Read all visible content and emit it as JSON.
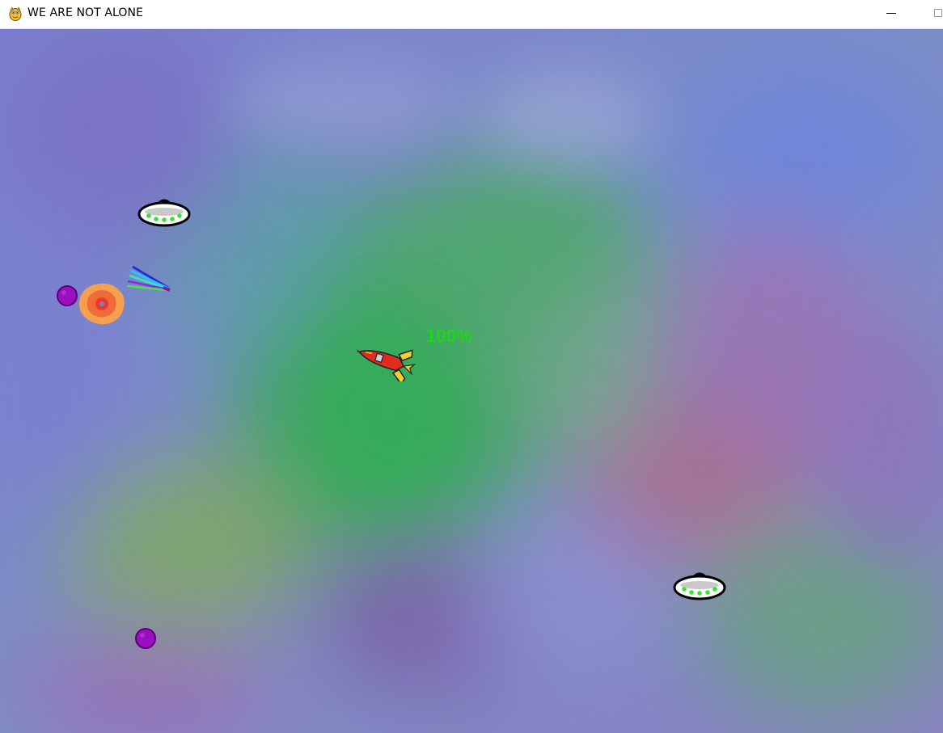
{
  "window": {
    "title": "WE ARE NOT ALONE",
    "icon": "pygame-snake-icon"
  },
  "controls": {
    "minimize_icon": "minimize-icon",
    "maximize_icon": "maximize-icon"
  },
  "hud": {
    "health_text": "100%",
    "health_color": "#1fd61f"
  },
  "colors": {
    "nebula_blue": "#7f87cc",
    "nebula_green": "#3fae5c",
    "nebula_purple": "#8a5fb0",
    "nebula_pink": "#b07aa0"
  },
  "sprites": {
    "player": "rocket-ship",
    "enemies": [
      "ufo-saucer",
      "ufo-saucer"
    ],
    "projectiles": [
      "purple-orb",
      "purple-orb"
    ],
    "effects": [
      "explosion-burst",
      "rainbow-laser-streak"
    ]
  }
}
